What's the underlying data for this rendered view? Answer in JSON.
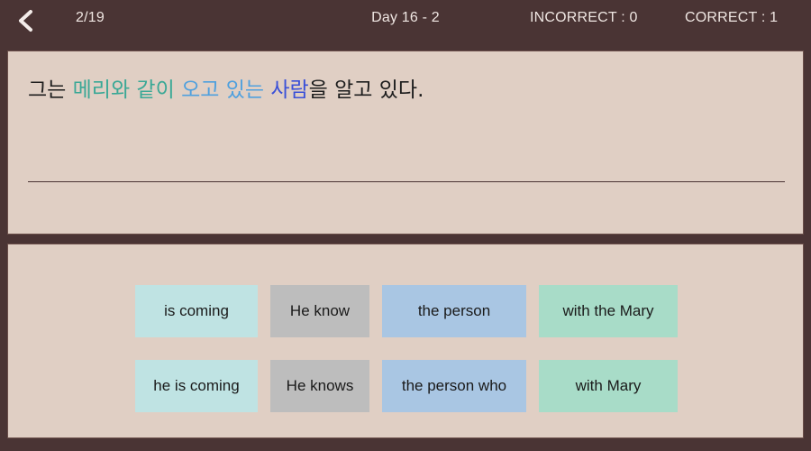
{
  "header": {
    "back_icon": "chevron-left-icon",
    "progress": "2/19",
    "title": "Day 16 - 2",
    "incorrect": "INCORRECT : 0",
    "correct": "CORRECT : 1",
    "background_color": "#4a3434",
    "text_color": "#efe6e2"
  },
  "question": {
    "panel_color": "#e0cfc4",
    "segments": [
      {
        "text": "그는 ",
        "color": "#1d1d1d"
      },
      {
        "text": "메리와 같이",
        "color": "#3aa896"
      },
      {
        "text": " ",
        "color": "#1d1d1d"
      },
      {
        "text": "오고 있는",
        "color": "#4fa0de"
      },
      {
        "text": " ",
        "color": "#1d1d1d"
      },
      {
        "text": "사람",
        "color": "#3a50d8"
      },
      {
        "text": "을 알고 있다.",
        "color": "#1d1d1d"
      }
    ],
    "full_text": "그는 메리와 같이 오고 있는 사람을 알고 있다.",
    "answer_value": "",
    "answer_placeholder": ""
  },
  "answers": {
    "panel_color": "#e0cfc4",
    "rows": [
      {
        "tiles": [
          {
            "label": "is coming",
            "color": "#bfe3e3"
          },
          {
            "label": "He know",
            "color": "#bdbdbd"
          },
          {
            "label": "the person",
            "color": "#a9c6e3"
          },
          {
            "label": "with the Mary",
            "color": "#a8dcc8"
          }
        ]
      },
      {
        "tiles": [
          {
            "label": "he is coming",
            "color": "#bfe3e3"
          },
          {
            "label": "He knows",
            "color": "#bdbdbd"
          },
          {
            "label": "the person who",
            "color": "#a9c6e3"
          },
          {
            "label": "with Mary",
            "color": "#a8dcc8"
          }
        ]
      }
    ]
  }
}
